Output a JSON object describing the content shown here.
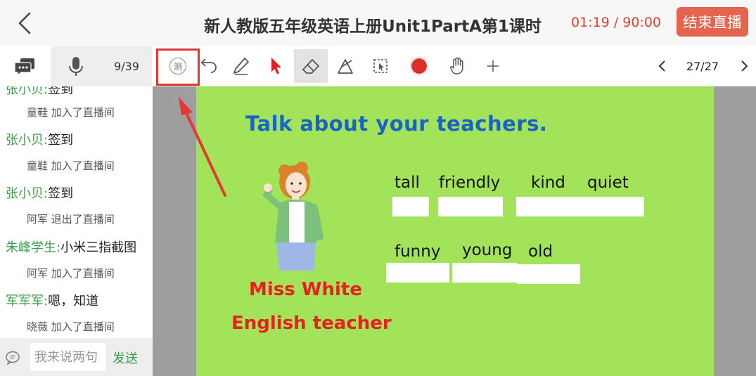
{
  "header": {
    "title": "新人教版五年级英语上册Unit1PartA第1课时",
    "timer": "01:19 / 90:00",
    "end_button": "结束直播"
  },
  "toolbar": {
    "participant_count": "9/39",
    "test_tool_label": "测",
    "page_indicator": "27/27",
    "record_color": "#d9302a"
  },
  "chat": {
    "lines": [
      {
        "type": "msg",
        "name": "张小贝:",
        "text": "签到"
      },
      {
        "type": "sys",
        "text": "童鞋  加入了直播间"
      },
      {
        "type": "msg",
        "name": "张小贝:",
        "text": "签到"
      },
      {
        "type": "sys",
        "text": "童鞋  加入了直播间"
      },
      {
        "type": "msg",
        "name": "张小贝:",
        "text": "签到"
      },
      {
        "type": "sys",
        "text": "阿军  退出了直播间"
      },
      {
        "type": "msg",
        "name": "朱峰学生:",
        "text": "小米三指截图"
      },
      {
        "type": "sys",
        "text": "阿军  加入了直播间"
      },
      {
        "type": "msg",
        "name": "军军军:",
        "text": "嗯，知道"
      },
      {
        "type": "sys",
        "text": "晓薇  加入了直播间"
      }
    ],
    "input_placeholder": "我来说两句",
    "send_label": "发送"
  },
  "slide": {
    "title": "Talk about your teachers.",
    "words_row1": [
      "tall",
      "friendly",
      "kind",
      "quiet"
    ],
    "words_row2": [
      "funny",
      "young",
      "old"
    ],
    "teacher_name": "Miss White",
    "teacher_role": "English teacher",
    "background": "#a3e35a",
    "title_color": "#1763c8",
    "name_color": "#e82020"
  }
}
